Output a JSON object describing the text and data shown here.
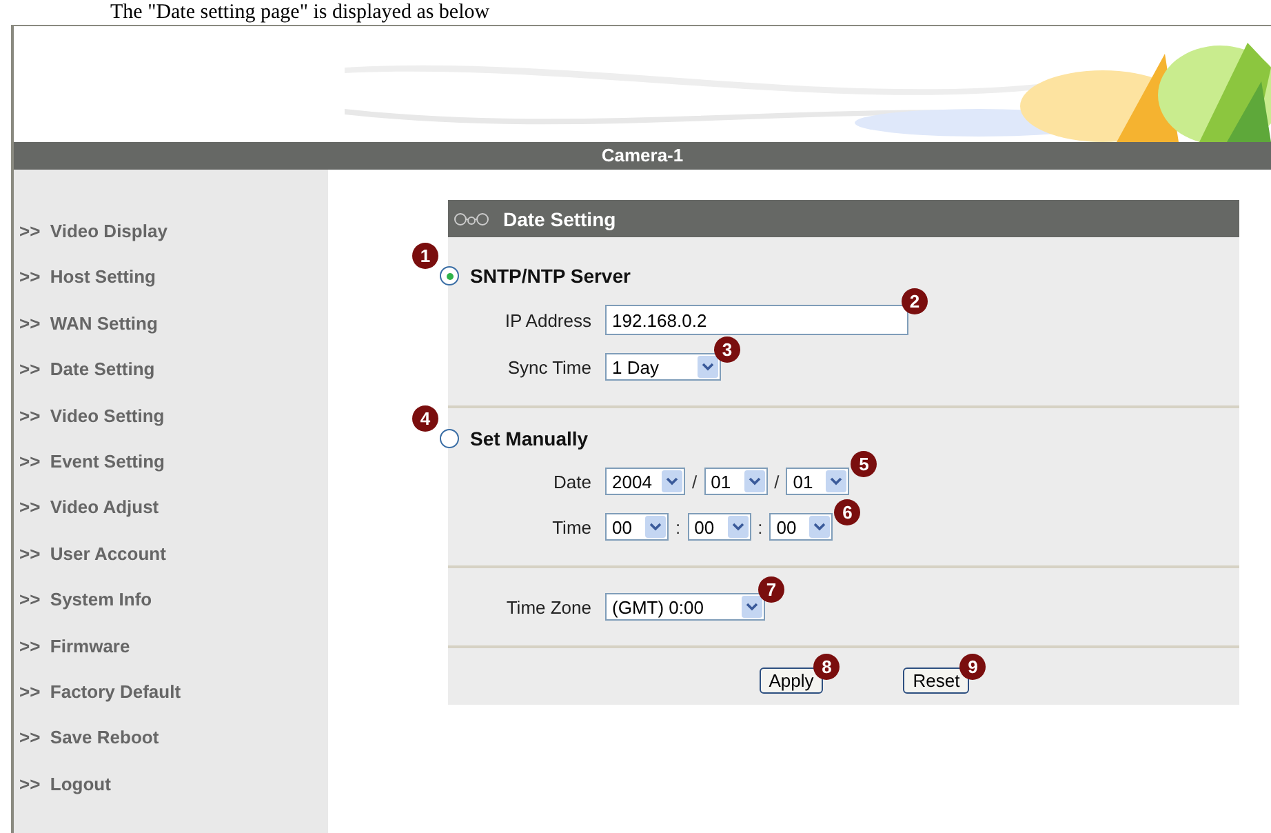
{
  "caption": "The \"Date setting page\" is displayed as below",
  "title_bar": "Camera-1",
  "sidebar": {
    "items": [
      {
        "label": ">>  Video Display"
      },
      {
        "label": ">>  Host Setting"
      },
      {
        "label": ">>  WAN Setting"
      },
      {
        "label": ">>  Date Setting"
      },
      {
        "label": ">>  Video Setting"
      },
      {
        "label": ">>  Event Setting"
      },
      {
        "label": ">>  Video Adjust"
      },
      {
        "label": ">>  User Account"
      },
      {
        "label": ">>  System Info"
      },
      {
        "label": ">>  Firmware"
      },
      {
        "label": ">>  Factory Default"
      },
      {
        "label": ">>  Save Reboot"
      },
      {
        "label": ">>  Logout"
      }
    ]
  },
  "panel": {
    "title": "Date Setting",
    "sntp": {
      "label": "SNTP/NTP Server",
      "selected": true,
      "callout": "1",
      "ip": {
        "label": "IP Address",
        "value": "192.168.0.2",
        "callout": "2"
      },
      "sync": {
        "label": "Sync Time",
        "value": "1 Day",
        "callout": "3"
      }
    },
    "manual": {
      "label": "Set Manually",
      "selected": false,
      "callout": "4",
      "date": {
        "label": "Date",
        "callout": "5",
        "items": [
          {
            "kind": "select",
            "value": "2004"
          },
          {
            "kind": "sep",
            "text": "/"
          },
          {
            "kind": "select",
            "value": "01"
          },
          {
            "kind": "sep",
            "text": "/"
          },
          {
            "kind": "select",
            "value": "01"
          }
        ]
      },
      "time": {
        "label": "Time",
        "callout": "6",
        "items": [
          {
            "kind": "select",
            "value": "00"
          },
          {
            "kind": "sep",
            "text": ":"
          },
          {
            "kind": "select",
            "value": "00"
          },
          {
            "kind": "sep",
            "text": ":"
          },
          {
            "kind": "select",
            "value": "00"
          }
        ]
      }
    },
    "timezone": {
      "label": "Time Zone",
      "value": "(GMT) 0:00",
      "callout": "7"
    },
    "buttons": [
      {
        "label": "Apply",
        "callout": "8"
      },
      {
        "label": "Reset",
        "callout": "9"
      }
    ]
  }
}
